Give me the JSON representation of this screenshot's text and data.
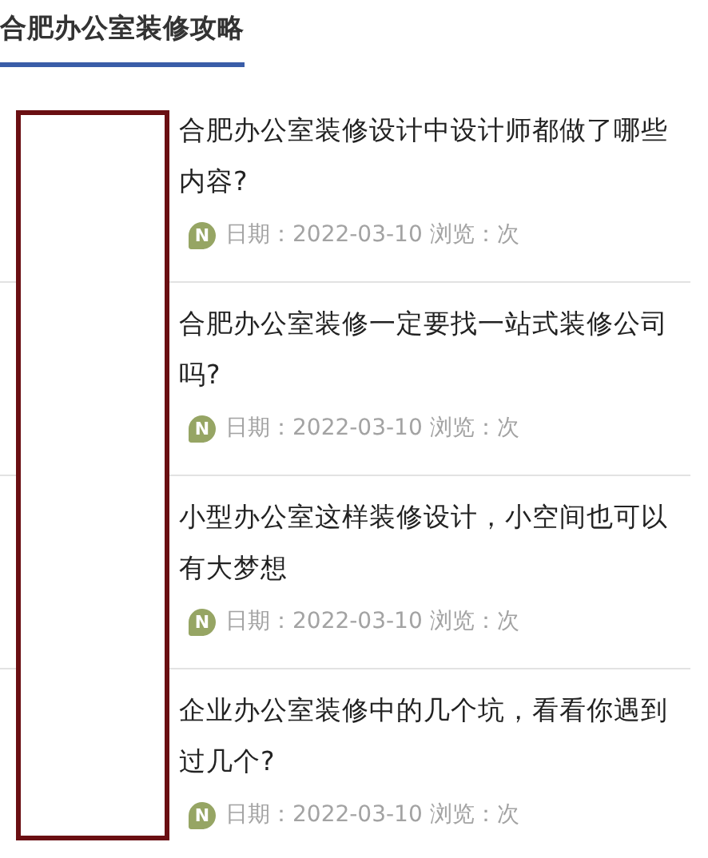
{
  "section": {
    "title": "合肥办公室装修攻略"
  },
  "articles": [
    {
      "title": "合肥办公室装修设计中设计师都做了哪些内容?",
      "badge": "N",
      "meta": "日期：2022-03-10 浏览：次"
    },
    {
      "title": "合肥办公室装修一定要找一站式装修公司吗?",
      "badge": "N",
      "meta": "日期：2022-03-10 浏览：次"
    },
    {
      "title": "小型办公室这样装修设计，小空间也可以有大梦想",
      "badge": "N",
      "meta": "日期：2022-03-10 浏览：次"
    },
    {
      "title": "企业办公室装修中的几个坑，看看你遇到过几个?",
      "badge": "N",
      "meta": "日期：2022-03-10 浏览：次"
    }
  ]
}
